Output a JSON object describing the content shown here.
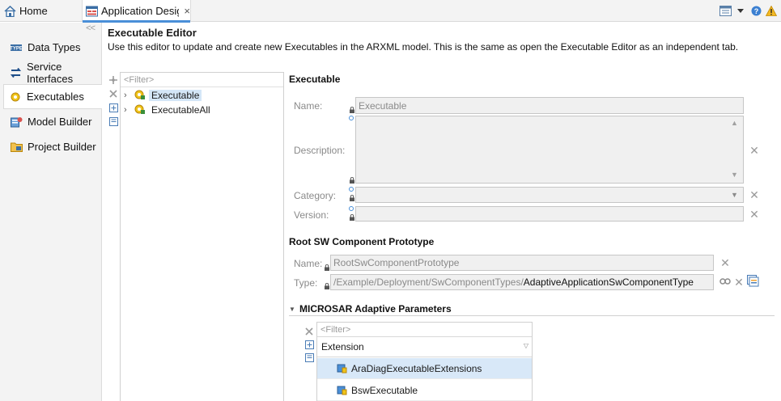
{
  "tabs": {
    "home_label": "Home",
    "adc_label": "Application Design Center",
    "close_glyph": "×"
  },
  "nav": {
    "collapse_label": "<<",
    "items": [
      {
        "label": "Data Types",
        "icon": "data-types-icon"
      },
      {
        "label": "Service Interfaces",
        "icon": "service-interfaces-icon"
      },
      {
        "label": "Executables",
        "icon": "executables-icon"
      },
      {
        "label": "Model Builder",
        "icon": "model-builder-icon"
      },
      {
        "label": "Project Builder",
        "icon": "project-builder-icon"
      }
    ],
    "active_index": 2
  },
  "editor": {
    "title": "Executable Editor",
    "description": "Use this editor to update and create new Executables in the ARXML model. This is the same as open the Executable Editor as an independent tab."
  },
  "tree": {
    "filter_placeholder": "<Filter>",
    "items": [
      {
        "label": "Executable",
        "selected": true
      },
      {
        "label": "ExecutableAll",
        "selected": false
      }
    ]
  },
  "executable": {
    "section_title": "Executable",
    "name_label": "Name:",
    "name_value": "Executable",
    "description_label": "Description:",
    "description_value": "",
    "category_label": "Category:",
    "category_value": "",
    "version_label": "Version:",
    "version_value": ""
  },
  "root_sw": {
    "section_title": "Root SW Component Prototype",
    "name_label": "Name:",
    "name_value": "RootSwComponentPrototype",
    "type_label": "Type:",
    "type_path": "/Example/Deployment/SwComponentTypes/",
    "type_name": "AdaptiveApplicationSwComponentType"
  },
  "microsar": {
    "section_title": "MICROSAR Adaptive Parameters",
    "filter_placeholder": "<Filter>",
    "column_header": "Extension",
    "rows": [
      {
        "label": "AraDiagExecutableExtensions",
        "selected": true
      },
      {
        "label": "BswExecutable",
        "selected": false
      }
    ]
  },
  "colors": {
    "accent": "#4a8fd8",
    "selection": "#d4e6f7",
    "field_bg": "#f0f0f0"
  }
}
